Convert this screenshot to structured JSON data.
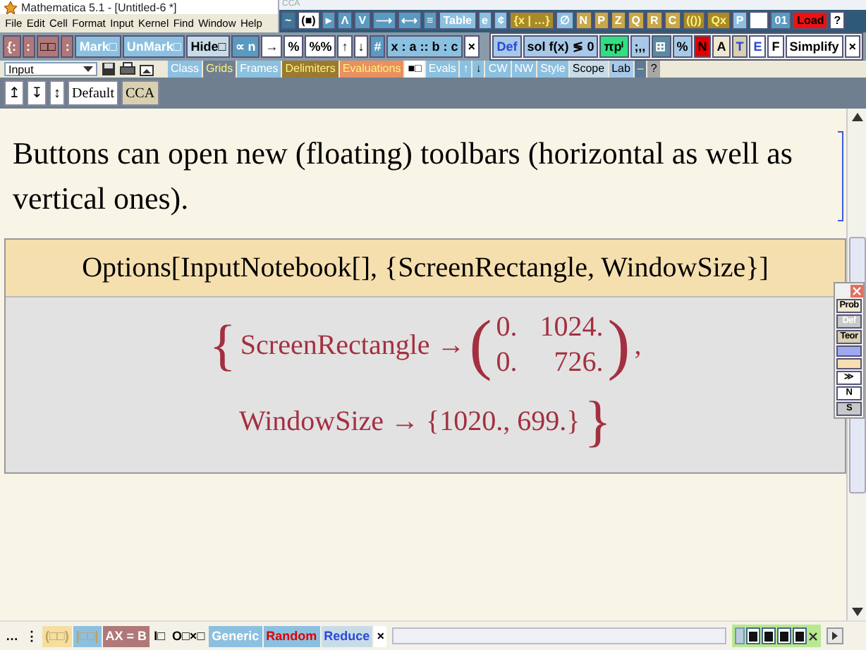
{
  "window": {
    "title": "Mathematica 5.1 - [Untitled-6 *]"
  },
  "menu": [
    "File",
    "Edit",
    "Cell",
    "Format",
    "Input",
    "Kernel",
    "Find",
    "Window",
    "Help"
  ],
  "cca_palette": {
    "title": "CCA",
    "buttons": [
      {
        "label": "~",
        "color": "#3f7699",
        "kind": "light"
      },
      {
        "label": "(■)",
        "color": "#ffffff",
        "kind": "dark"
      },
      {
        "label": "▸",
        "color": "#5a9ac0",
        "kind": "light"
      },
      {
        "label": "Λ",
        "color": "#5a9ac0",
        "kind": "light"
      },
      {
        "label": "V",
        "color": "#5a9ac0",
        "kind": "light"
      },
      {
        "label": "⟶",
        "color": "#5a9ac0",
        "kind": "light"
      },
      {
        "label": "⟷",
        "color": "#5a9ac0",
        "kind": "light"
      },
      {
        "label": "≡",
        "color": "#5a9ac0",
        "kind": "light"
      },
      {
        "label": "Table",
        "color": "#8cc0e0",
        "kind": "light"
      },
      {
        "label": "e",
        "color": "#8cc0e0",
        "kind": "light"
      },
      {
        "label": "¢",
        "color": "#8cc0e0",
        "kind": "light"
      },
      {
        "label": "{x | …}",
        "color": "#a88a28",
        "kind": "yellow"
      },
      {
        "label": "∅",
        "color": "#8cc0e0",
        "kind": "light"
      },
      {
        "label": "N",
        "color": "#c8a848",
        "kind": "light"
      },
      {
        "label": "P",
        "color": "#c8a848",
        "kind": "light"
      },
      {
        "label": "Z",
        "color": "#c8a848",
        "kind": "light"
      },
      {
        "label": "Q",
        "color": "#c8a848",
        "kind": "light"
      },
      {
        "label": "R",
        "color": "#c8a848",
        "kind": "light"
      },
      {
        "label": "C",
        "color": "#c8a848",
        "kind": "light"
      },
      {
        "label": "(())",
        "color": "#a88a28",
        "kind": "yellow"
      },
      {
        "label": "Qx",
        "color": "#a88a28",
        "kind": "yellow"
      },
      {
        "label": "P",
        "color": "#8cc0e0",
        "kind": "light"
      },
      {
        "color": "#ffffff",
        "kind": "blank"
      },
      {
        "label": "01",
        "color": "#5a9ac0",
        "kind": "light"
      },
      {
        "label": "Load",
        "color": "#ee1111",
        "kind": "dark"
      },
      {
        "label": "?",
        "color": "#ffffff",
        "kind": "dark"
      }
    ]
  },
  "toolbar": [
    {
      "label": "{:",
      "color": "#b07878",
      "kind": "light"
    },
    {
      "label": ":",
      "color": "#b07878",
      "kind": "light"
    },
    {
      "label": "□□",
      "color": "#b07878",
      "kind": "dark"
    },
    {
      "label": ":",
      "color": "#b07878",
      "kind": "light"
    },
    {
      "label": "Mark□",
      "color": "#8cc0e0",
      "kind": "light"
    },
    {
      "label": "UnMark□",
      "color": "#8cc0e0",
      "kind": "light"
    },
    {
      "label": "Hide□",
      "color": "#c8dce8",
      "kind": "dark"
    },
    {
      "label": "∝ n",
      "color": "#5a9ac0",
      "kind": "light"
    },
    {
      "label": "→",
      "color": "#ffffff",
      "kind": "dark"
    },
    {
      "label": "%",
      "color": "#ffffff",
      "kind": "dark"
    },
    {
      "label": "%%",
      "color": "#ffffff",
      "kind": "dark"
    },
    {
      "label": "↑",
      "color": "#ffffff",
      "kind": "dark"
    },
    {
      "label": "↓",
      "color": "#ffffff",
      "kind": "dark"
    },
    {
      "label": "#",
      "color": "#5a9ac0",
      "kind": "light"
    },
    {
      "label": "x : a :: b : c",
      "color": "#8cc0e0",
      "kind": "dark"
    },
    {
      "label": "×",
      "color": "#ffffff",
      "kind": "dark"
    }
  ],
  "def_palette": [
    {
      "label": "Def",
      "color": "#a8c8e8",
      "kind": "blue"
    },
    {
      "label": "sol f(x) ≶ 0",
      "color": "#a8c8e8",
      "kind": "dark"
    },
    {
      "label": "πpⁱ",
      "color": "#30e080",
      "kind": "dark"
    },
    {
      "label": ";,,",
      "color": "#a8c8e8",
      "kind": "dark"
    },
    {
      "label": "⊞",
      "color": "#5a8aa0",
      "kind": "light"
    },
    {
      "label": "%",
      "color": "#a8c8e8",
      "kind": "dark"
    },
    {
      "label": "N",
      "color": "#e00000",
      "kind": "dark"
    },
    {
      "label": "A",
      "color": "#f0e8d0",
      "kind": "dark"
    },
    {
      "label": "T",
      "color": "#d8d0b0",
      "kind": "blue"
    },
    {
      "label": "E",
      "color": "#ffffff",
      "kind": "blue"
    },
    {
      "label": "F",
      "color": "#ffffff",
      "kind": "dark"
    },
    {
      "label": "Simplify",
      "color": "#ffffff",
      "kind": "dark"
    },
    {
      "label": "×",
      "color": "#ffffff",
      "kind": "dark"
    }
  ],
  "style_menu": {
    "value": "Input"
  },
  "tabs_palette": [
    {
      "label": "Class",
      "color": "#8cc0e0",
      "kind": "light"
    },
    {
      "label": "Grids",
      "color": "#708090",
      "kind": "yellow"
    },
    {
      "label": "Frames",
      "color": "#8cc0e0",
      "kind": "light"
    },
    {
      "label": "Delimiters",
      "color": "#9a7a30",
      "kind": "yellow"
    },
    {
      "label": "Evaluations",
      "color": "#e89060",
      "kind": "yellow"
    },
    {
      "label": "■□",
      "color": "#ffffff",
      "kind": "dark"
    },
    {
      "label": "Evals",
      "color": "#8cc0e0",
      "kind": "light"
    },
    {
      "label": "↑",
      "color": "#8cc0e0",
      "kind": "light"
    },
    {
      "label": "↓",
      "color": "#8cc0e0",
      "kind": "dark"
    },
    {
      "label": "CW",
      "color": "#8cc0e0",
      "kind": "light"
    },
    {
      "label": "NW",
      "color": "#8cc0e0",
      "kind": "light"
    },
    {
      "label": "Style",
      "color": "#8cc0e0",
      "kind": "light"
    },
    {
      "label": "Scope",
      "color": "#c8dce8",
      "kind": "dark"
    },
    {
      "label": "Lab",
      "color": "#a8c8e8",
      "kind": "dark"
    },
    {
      "label": "–",
      "color": "#5a7a98",
      "kind": "yellow"
    },
    {
      "label": "?",
      "color": "#a8a8a8",
      "kind": "dark"
    }
  ],
  "style_bar": [
    {
      "label": "↥",
      "color": "#ffffff",
      "kind": "dark"
    },
    {
      "label": "↧",
      "color": "#ffffff",
      "kind": "dark"
    },
    {
      "label": "↕",
      "color": "#ffffff",
      "kind": "dark"
    },
    {
      "label": "Default",
      "color": "#ffffff",
      "kind": "dark"
    },
    {
      "label": "CCA",
      "color": "#d8d0b0",
      "kind": "dark"
    }
  ],
  "notebook": {
    "text_cell": "Buttons can open new (floating) toolbars (horizontal as well as vertical ones).",
    "input_cell": "Options[InputNotebook[], {ScreenRectangle, WindowSize}]",
    "output_cell": {
      "brace_open": "{",
      "rule_1": "ScreenRectangle →",
      "paren_open": "(",
      "matrix": [
        [
          "0.",
          "1024."
        ],
        [
          "0.",
          "726."
        ]
      ],
      "paren_close": ")",
      "comma": ",",
      "rule_2": "WindowSize → {1020., 699.}",
      "brace_close": "}"
    }
  },
  "side_palette": [
    {
      "label": "Prob",
      "color": "#f0e8d0",
      "kind": "dark"
    },
    {
      "label": "Def",
      "color": "#c8c8c8",
      "kind": "light"
    },
    {
      "label": "Teor",
      "color": "#d8d0b0",
      "kind": "dark"
    },
    {
      "color": "#a0a8f0",
      "kind": "blank"
    },
    {
      "color": "#f5dfb0",
      "kind": "blank"
    },
    {
      "label": "≫",
      "color": "#ffffff",
      "kind": "dark"
    },
    {
      "label": "N",
      "color": "#ffffff",
      "kind": "dark"
    },
    {
      "label": "S",
      "color": "#c8c8c8",
      "kind": "dark"
    }
  ],
  "bottom_palette": [
    {
      "label": "…",
      "color": "#f4f2e8",
      "kind": "dark"
    },
    {
      "label": "⋮",
      "color": "#f4f2e8",
      "kind": "dark"
    },
    {
      "label": "(□□)",
      "color": "#f5dfa0",
      "kind": "tan"
    },
    {
      "label": "|□□|",
      "color": "#8cc0e0",
      "kind": "tan"
    },
    {
      "label": "AX = B",
      "color": "#b07878",
      "kind": "light"
    },
    {
      "label": "I□",
      "color": "#f4f2e8",
      "kind": "dark"
    },
    {
      "label": "O□×□",
      "color": "#f4f2e8",
      "kind": "dark"
    },
    {
      "label": "Generic",
      "color": "#8cc0e0",
      "kind": "light"
    },
    {
      "label": "Random",
      "color": "#8cc0e0",
      "kind": "red"
    },
    {
      "label": "Reduce",
      "color": "#c8dce8",
      "kind": "blue"
    },
    {
      "label": "×",
      "color": "#ffffff",
      "kind": "dark"
    }
  ]
}
